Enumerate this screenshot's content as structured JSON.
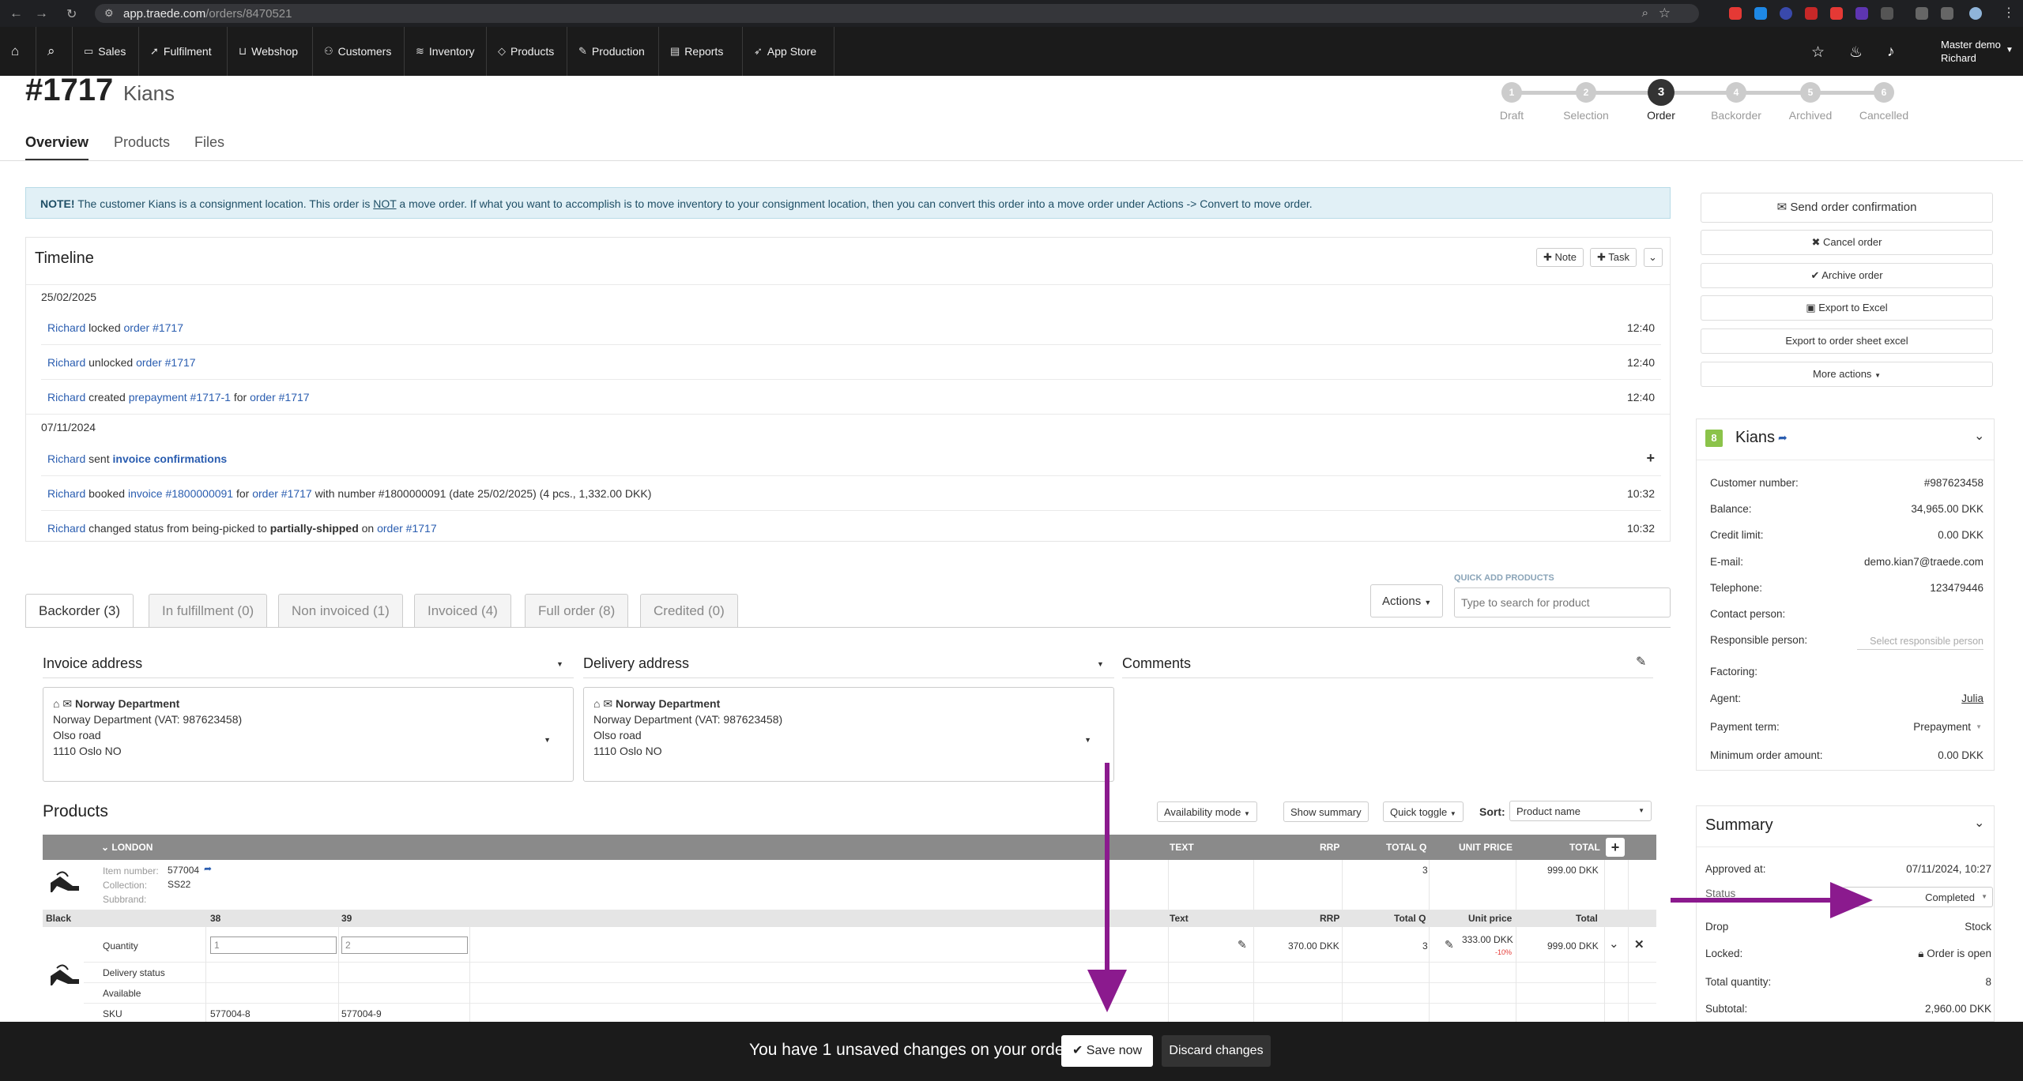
{
  "browser": {
    "url_host": "app.traede.com",
    "url_path": "/orders/8470521"
  },
  "nav": {
    "items": [
      "Sales",
      "Fulfilment",
      "Webshop",
      "Customers",
      "Inventory",
      "Products",
      "Production",
      "Reports",
      "App Store"
    ],
    "user_line1": "Master demo",
    "user_line2": "Richard"
  },
  "order": {
    "number": "#1717",
    "customer": "Kians"
  },
  "tabs": [
    "Overview",
    "Products",
    "Files"
  ],
  "steps": [
    {
      "n": "1",
      "label": "Draft"
    },
    {
      "n": "2",
      "label": "Selection"
    },
    {
      "n": "3",
      "label": "Order"
    },
    {
      "n": "4",
      "label": "Backorder"
    },
    {
      "n": "5",
      "label": "Archived"
    },
    {
      "n": "6",
      "label": "Cancelled"
    }
  ],
  "note": {
    "bold": "NOTE!",
    "part1": " The customer Kians is a consignment location. This order is ",
    "underline": "NOT",
    "part2": " a move order. If what you want to accomplish is to move inventory to your consignment location, then you can convert this order into a move order under Actions -> Convert to move order."
  },
  "timeline": {
    "title": "Timeline",
    "note_btn": "Note",
    "task_btn": "Task",
    "date1": "25/02/2025",
    "date2": "07/11/2024",
    "rows": [
      {
        "user": "Richard",
        "a": " locked ",
        "link": "order #1717",
        "b": "",
        "link2": "",
        "c": "",
        "time": "12:40"
      },
      {
        "user": "Richard",
        "a": " unlocked ",
        "link": "order #1717",
        "b": "",
        "link2": "",
        "c": "",
        "time": "12:40"
      },
      {
        "user": "Richard",
        "a": " created ",
        "link": "prepayment #1717-1",
        "b": " for ",
        "link2": "order #1717",
        "c": "",
        "time": "12:40"
      },
      {
        "user": "Richard",
        "a": " sent ",
        "link": "invoice confirmations",
        "b": "",
        "link2": "",
        "c": "",
        "time": ""
      },
      {
        "user": "Richard",
        "a": " booked ",
        "link": "invoice #1800000091",
        "b": " for ",
        "link2": "order #1717",
        "c": " with number #1800000091 (date 25/02/2025) (4 pcs., 1,332.00 DKK)",
        "time": "10:32"
      },
      {
        "user": "Richard",
        "a": " changed status from being-picked to ",
        "bold": "partially-shipped",
        "b": " on ",
        "link2": "order #1717",
        "c": "",
        "time": "10:32"
      }
    ]
  },
  "order_tabs": [
    "Backorder (3)",
    "In fulfillment (0)",
    "Non invoiced (1)",
    "Invoiced (4)",
    "Full order (8)",
    "Credited (0)"
  ],
  "actions_btn": "Actions",
  "quick_add": {
    "label": "QUICK ADD PRODUCTS",
    "placeholder": "Type to search for product"
  },
  "invoice_address": {
    "title": "Invoice address",
    "name": "Norway Department",
    "line1": "Norway Department (VAT: 987623458)",
    "line2": "Olso road",
    "line3": "1110 Oslo NO"
  },
  "delivery_address": {
    "title": "Delivery address",
    "name": "Norway Department",
    "line1": "Norway Department (VAT: 987623458)",
    "line2": "Olso road",
    "line3": "1110 Oslo NO"
  },
  "comments_title": "Comments",
  "products": {
    "title": "Products",
    "availability": "Availability mode",
    "show_summary": "Show summary",
    "quick_toggle": "Quick toggle",
    "sort_label": "Sort:",
    "sort_value": "Product name",
    "group": "LONDON",
    "headers": [
      "TEXT",
      "RRP",
      "TOTAL Q",
      "UNIT PRICE",
      "TOTAL"
    ],
    "item_label": "Item number:",
    "item_number": "577004",
    "collection_label": "Collection:",
    "collection": "SS22",
    "subbrand_label": "Subbrand:",
    "total_q": "3",
    "total": "999.00 DKK",
    "variant": {
      "color": "Black",
      "sizes": [
        "38",
        "39"
      ],
      "sub_headers": [
        "Text",
        "RRP",
        "Total Q",
        "Unit price",
        "Total"
      ],
      "row_labels": [
        "Quantity",
        "Delivery status",
        "Available",
        "SKU"
      ],
      "quantities": [
        "1",
        "2"
      ],
      "skus": [
        "577004-8",
        "577004-9"
      ],
      "rrp": "370.00 DKK",
      "total_q": "3",
      "unit_price": "333.00 DKK",
      "discount": "-10%",
      "total": "999.00 DKK"
    }
  },
  "right": {
    "buttons": [
      "Send order confirmation",
      "Cancel order",
      "Archive order",
      "Export to Excel",
      "Export to order sheet excel",
      "More actions"
    ],
    "customer_badge": "8",
    "customer_name": "Kians",
    "fields": [
      {
        "k": "Customer number:",
        "v": "#987623458"
      },
      {
        "k": "Balance:",
        "v": "34,965.00 DKK"
      },
      {
        "k": "Credit limit:",
        "v": "0.00 DKK"
      },
      {
        "k": "E-mail:",
        "v": "demo.kian7@traede.com"
      },
      {
        "k": "Telephone:",
        "v": "123479446"
      },
      {
        "k": "Contact person:",
        "v": ""
      },
      {
        "k": "Responsible person:",
        "v": "Select responsible person"
      },
      {
        "k": "Factoring:",
        "v": ""
      },
      {
        "k": "Agent:",
        "v": "Julia"
      },
      {
        "k": "Payment term:",
        "v": "Prepayment"
      },
      {
        "k": "Minimum order amount:",
        "v": "0.00 DKK"
      }
    ],
    "summary_title": "Summary",
    "summary": [
      {
        "k": "Approved at:",
        "v": "07/11/2024, 10:27"
      },
      {
        "k": "Status",
        "v": "Completed"
      },
      {
        "k": "Drop",
        "v": "Stock"
      },
      {
        "k": "Locked:",
        "v": "Order is open"
      },
      {
        "k": "Total quantity:",
        "v": "8"
      },
      {
        "k": "Subtotal:",
        "v": "2,960.00 DKK"
      }
    ]
  },
  "bottom": {
    "message": "You have 1 unsaved changes on your order",
    "save": "Save now",
    "discard": "Discard changes"
  },
  "colors": {
    "annotation_arrow": "#8b1a8e",
    "nav_bg": "#1b1b1b",
    "note_bg": "#e1f0f6",
    "badge": "#8bc34a"
  }
}
